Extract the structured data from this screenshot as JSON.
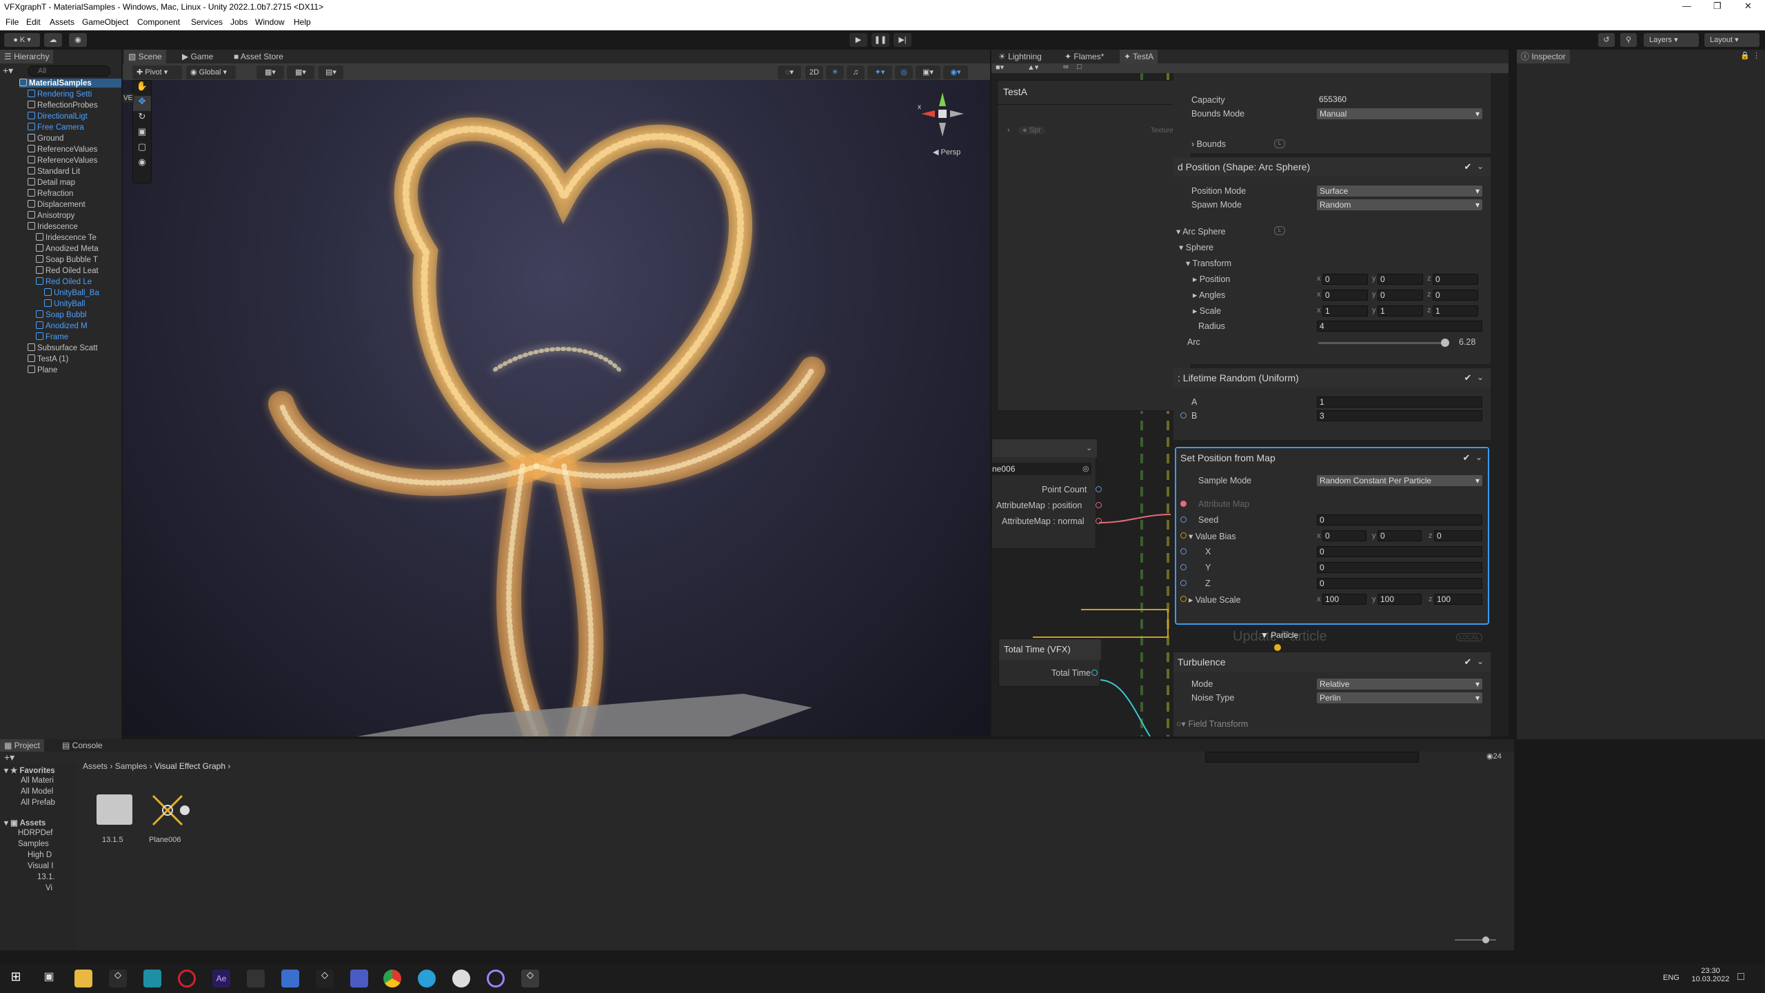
{
  "window": {
    "title": "VFXgraphT - MaterialSamples - Windows, Mac, Linux - Unity 2022.1.0b7.2715 <DX11>"
  },
  "menu": [
    "File",
    "Edit",
    "Assets",
    "GameObject",
    "Component",
    "Services",
    "Jobs",
    "Window",
    "Help"
  ],
  "toolbar": {
    "account": "K",
    "layers": "Layers",
    "layout": "Layout"
  },
  "hierarchy": {
    "tab": "Hierarchy",
    "search_placeholder": "All",
    "items": [
      {
        "label": "MaterialSamples",
        "blue": false,
        "bold": true
      },
      {
        "label": "Rendering Setti",
        "blue": true
      },
      {
        "label": "ReflectionProbes",
        "blue": false
      },
      {
        "label": "DirectionalLigt",
        "blue": true
      },
      {
        "label": "Free Camera",
        "blue": true
      },
      {
        "label": "Ground",
        "blue": false
      },
      {
        "label": "ReferenceValues",
        "blue": false
      },
      {
        "label": "ReferenceValues",
        "blue": false
      },
      {
        "label": "Standard Lit",
        "blue": false
      },
      {
        "label": "Detail map",
        "blue": false
      },
      {
        "label": "Refraction",
        "blue": false
      },
      {
        "label": "Displacement",
        "blue": false
      },
      {
        "label": "Anisotropy",
        "blue": false
      },
      {
        "label": "Iridescence",
        "blue": false
      },
      {
        "label": "Iridescence Te",
        "blue": false
      },
      {
        "label": "Anodized Meta",
        "blue": false
      },
      {
        "label": "Soap Bubble T",
        "blue": false
      },
      {
        "label": "Red Oiled Leat",
        "blue": false
      },
      {
        "label": "Red Oiled Le",
        "blue": true
      },
      {
        "label": "UnityBall_Ba",
        "blue": true
      },
      {
        "label": "UnityBall",
        "blue": true
      },
      {
        "label": "Soap Bubbl",
        "blue": true
      },
      {
        "label": "Anodized M",
        "blue": true
      },
      {
        "label": "Frame",
        "blue": true
      },
      {
        "label": "Subsurface Scatt",
        "blue": false
      },
      {
        "label": "TestA (1)",
        "blue": false
      },
      {
        "label": "Plane",
        "blue": false
      }
    ]
  },
  "scene": {
    "tabs": [
      "Scene",
      "Game",
      "Asset Store"
    ],
    "pivot": "Pivot",
    "global": "Global",
    "mode2d": "2D",
    "persp": "Persp",
    "ve": "VE"
  },
  "vfx": {
    "tabs": [
      "Lightning",
      "Flames*",
      "TestA"
    ],
    "blackboard_title": "TestA",
    "blackboard_item": "Spr",
    "blackboard_type": "Texture2D",
    "pcache_name": "ne006",
    "ports": [
      "Point Count",
      "AttributeMap : position",
      "AttributeMap : normal"
    ],
    "total_time_node": "Total Time (VFX)",
    "total_time_port": "Total Time",
    "capacity_label": "Capacity",
    "capacity_value": "655360",
    "bounds_mode_label": "Bounds Mode",
    "bounds_mode_value": "Manual",
    "bounds_label": "Bounds",
    "set_position_title": "d Position (Shape: Arc Sphere)",
    "position_mode_label": "Position Mode",
    "position_mode_value": "Surface",
    "spawn_mode_label": "Spawn Mode",
    "spawn_mode_value": "Random",
    "arc_sphere": "Arc Sphere",
    "sphere": "Sphere",
    "transform": "Transform",
    "position": "Position",
    "angles": "Angles",
    "scale": "Scale",
    "radius_label": "Radius",
    "radius_value": "4",
    "arc_label": "Arc",
    "arc_value": "6.28",
    "pos_vals": [
      "0",
      "0",
      "0"
    ],
    "ang_vals": [
      "0",
      "0",
      "0"
    ],
    "scale_vals": [
      "1",
      "1",
      "1"
    ],
    "lifetime_title": "Lifetime Random (Uniform)",
    "a_label": "A",
    "a_value": "1",
    "b_label": "B",
    "b_value": "3",
    "setpos_map_title": "Set Position from Map",
    "sample_mode_label": "Sample Mode",
    "sample_mode_value": "Random Constant Per Particle",
    "attribute_map_label": "Attribute Map",
    "seed_label": "Seed",
    "seed_value": "0",
    "value_bias_label": "Value Bias",
    "bias_vals": [
      "0",
      "0",
      "0"
    ],
    "x_label": "X",
    "x_value": "0",
    "y_label": "Y",
    "y_value": "0",
    "z_label": "Z",
    "z_value": "0",
    "value_scale_label": "Value Scale",
    "scale2_vals": [
      "100",
      "100",
      "100"
    ],
    "update_particle": "Update Particle",
    "particle_label": "Particle",
    "local_label": "LOCAL",
    "turbulence_title": "Turbulence",
    "mode_label": "Mode",
    "mode_value": "Relative",
    "noise_type_label": "Noise Type",
    "noise_type_value": "Perlin",
    "field_transform": "Field Transform"
  },
  "inspector": {
    "tab": "Inspector"
  },
  "project": {
    "tabs": [
      "Project",
      "Console"
    ],
    "breadcrumb": [
      "Assets",
      "Samples",
      "Visual Effect Graph"
    ],
    "favorites": "Favorites",
    "fav_items": [
      "All Materi",
      "All Model",
      "All Prefab"
    ],
    "assets_label": "Assets",
    "tree": [
      "HDRPDef",
      "Samples",
      "High D",
      "Visual I",
      "13.1.",
      "Vi"
    ],
    "files": [
      {
        "name": "13.1.5",
        "kind": "folder"
      },
      {
        "name": "Plane006",
        "kind": "vfx"
      }
    ],
    "count": "24"
  },
  "taskbar": {
    "lang": "ENG",
    "time": "23:30",
    "date": "10.03.2022"
  },
  "colors": {
    "accent": "#4aa0ff",
    "selected_outline": "#3b9cf0",
    "node_bg": "#2b2b2b"
  }
}
